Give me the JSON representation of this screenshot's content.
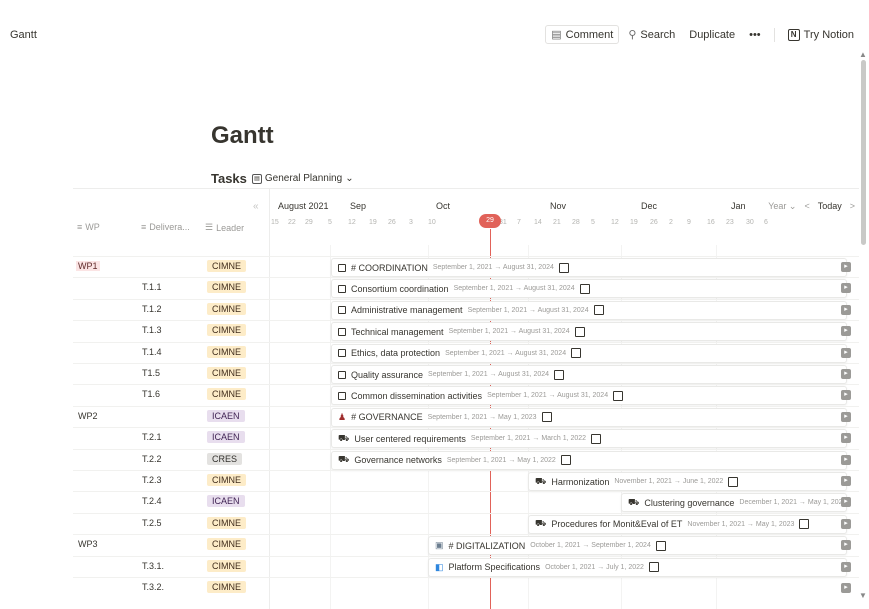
{
  "breadcrumb": "Gantt",
  "topbar": {
    "comment": "Comment",
    "search": "Search",
    "duplicate": "Duplicate",
    "more": "•••",
    "try_notion": "Try Notion"
  },
  "page_title": "Gantt",
  "view": {
    "name": "Tasks",
    "selected_view": "General Planning"
  },
  "columns": {
    "wp": "WP",
    "deliverable": "Delivera...",
    "leader": "Leader"
  },
  "timeline": {
    "months": [
      "August 2021",
      "Sep",
      "Oct",
      "Nov",
      "Dec",
      "Jan"
    ],
    "days": [
      "15",
      "22",
      "29",
      "5",
      "12",
      "19",
      "26",
      "3",
      "10",
      "29",
      "31",
      "7",
      "14",
      "21",
      "28",
      "5",
      "12",
      "19",
      "26",
      "2",
      "9",
      "16",
      "23",
      "30",
      "6"
    ],
    "today_label": "29",
    "scale": "Year",
    "today": "Today"
  },
  "rows": [
    {
      "wp": "WP1",
      "deliverable": "",
      "leader": "CIMNE",
      "task": "# COORDINATION",
      "dates": "September 1, 2021 → August 31, 2024",
      "icon": "checkbox",
      "check": true
    },
    {
      "wp": "",
      "deliverable": "T.1.1",
      "leader": "CIMNE",
      "task": "Consortium coordination",
      "dates": "September 1, 2021 → August 31, 2024",
      "icon": "checkbox",
      "check": true
    },
    {
      "wp": "",
      "deliverable": "T.1.2",
      "leader": "CIMNE",
      "task": "Administrative management",
      "dates": "September 1, 2021 → August 31, 2024",
      "icon": "checkbox",
      "check": true
    },
    {
      "wp": "",
      "deliverable": "T.1.3",
      "leader": "CIMNE",
      "task": "Technical management",
      "dates": "September 1, 2021 → August 31, 2024",
      "icon": "checkbox",
      "check": true
    },
    {
      "wp": "",
      "deliverable": "T.1.4",
      "leader": "CIMNE",
      "task": "Ethics, data protection",
      "dates": "September 1, 2021 → August 31, 2024",
      "icon": "checkbox",
      "check": true
    },
    {
      "wp": "",
      "deliverable": "T1.5",
      "leader": "CIMNE",
      "task": "Quality assurance",
      "dates": "September 1, 2021 → August 31, 2024",
      "icon": "checkbox",
      "check": true
    },
    {
      "wp": "",
      "deliverable": "T1.6",
      "leader": "CIMNE",
      "task": "Common dissemination activities",
      "dates": "September 1, 2021 → August 31, 2024",
      "icon": "checkbox",
      "check": true
    },
    {
      "wp": "WP2",
      "deliverable": "",
      "leader": "ICAEN",
      "task": "# GOVERNANCE",
      "dates": "September 1, 2021 → May 1, 2023",
      "icon": "person",
      "check": true
    },
    {
      "wp": "",
      "deliverable": "T.2.1",
      "leader": "ICAEN",
      "task": "User centered requirements",
      "dates": "September 1, 2021 → March 1, 2022",
      "icon": "car",
      "check": true
    },
    {
      "wp": "",
      "deliverable": "T.2.2",
      "leader": "CRES",
      "task": "Governance networks",
      "dates": "September 1, 2021 → May 1, 2022",
      "icon": "car",
      "check": true
    },
    {
      "wp": "",
      "deliverable": "T.2.3",
      "leader": "CIMNE",
      "task": "Harmonization",
      "dates": "November 1, 2021 → June 1, 2022",
      "icon": "car",
      "check": true
    },
    {
      "wp": "",
      "deliverable": "T.2.4",
      "leader": "ICAEN",
      "task": "Clustering governance",
      "dates": "December 1, 2021 → May 1, 202",
      "icon": "car",
      "check": false
    },
    {
      "wp": "",
      "deliverable": "T.2.5",
      "leader": "CIMNE",
      "task": "Procedures for Monit&Eval of ET",
      "dates": "November 1, 2021 → May 1, 2023",
      "icon": "car",
      "check": true
    },
    {
      "wp": "WP3",
      "deliverable": "",
      "leader": "CIMNE",
      "task": "# DIGITALIZATION",
      "dates": "October 1, 2021 → September 1, 2024",
      "icon": "chip",
      "check": true
    },
    {
      "wp": "",
      "deliverable": "T.3.1.",
      "leader": "CIMNE",
      "task": "Platform Specifications",
      "dates": "October 1, 2021 → July 1, 2022",
      "icon": "blue",
      "check": true
    },
    {
      "wp": "",
      "deliverable": "T.3.2.",
      "leader": "CIMNE",
      "task": "",
      "dates": "",
      "icon": "",
      "check": false
    }
  ]
}
